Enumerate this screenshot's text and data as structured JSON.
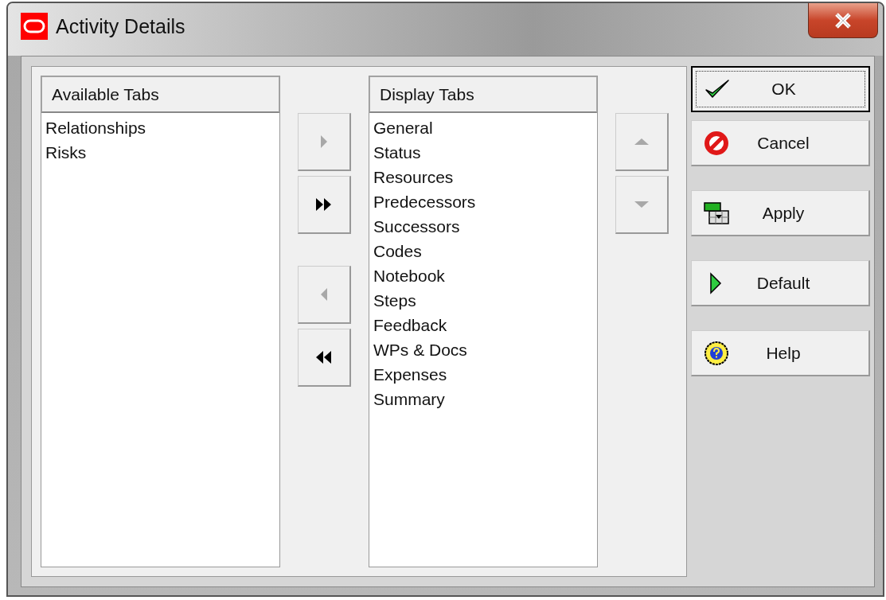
{
  "window": {
    "title": "Activity Details"
  },
  "available": {
    "header": "Available Tabs",
    "items": [
      "Relationships",
      "Risks"
    ]
  },
  "move_buttons": [
    {
      "kind": "right",
      "disabled": true
    },
    {
      "kind": "all-right",
      "disabled": false
    },
    {
      "kind": "left",
      "disabled": true
    },
    {
      "kind": "all-left",
      "disabled": false
    }
  ],
  "display": {
    "header": "Display Tabs",
    "items": [
      "General",
      "Status",
      "Resources",
      "Predecessors",
      "Successors",
      "Codes",
      "Notebook",
      "Steps",
      "Feedback",
      "WPs & Docs",
      "Expenses",
      "Summary"
    ]
  },
  "order_buttons": [
    {
      "kind": "up",
      "disabled": true
    },
    {
      "kind": "down",
      "disabled": true
    }
  ],
  "buttons": [
    {
      "label": "OK",
      "kind": "ok",
      "default": true
    },
    {
      "label": "Cancel",
      "kind": "cancel",
      "default": false
    },
    {
      "label": "Apply",
      "kind": "apply",
      "default": false
    },
    {
      "label": "Default",
      "kind": "default",
      "default": false
    },
    {
      "label": "Help",
      "kind": "help",
      "default": false
    }
  ]
}
